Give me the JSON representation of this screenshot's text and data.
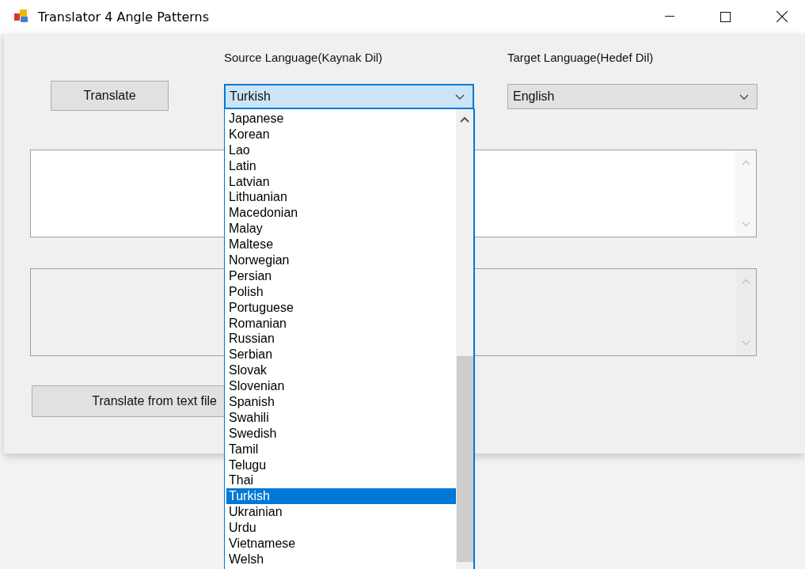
{
  "window": {
    "title": "Translator 4 Angle Patterns"
  },
  "translate_button": "Translate",
  "source": {
    "label": "Source Language(Kaynak Dil)",
    "value": "Turkish",
    "focused": true,
    "expanded": true,
    "options": [
      {
        "label": "Japanese",
        "selected": false
      },
      {
        "label": "Korean",
        "selected": false
      },
      {
        "label": "Lao",
        "selected": false
      },
      {
        "label": "Latin",
        "selected": false
      },
      {
        "label": "Latvian",
        "selected": false
      },
      {
        "label": "Lithuanian",
        "selected": false
      },
      {
        "label": "Macedonian",
        "selected": false
      },
      {
        "label": "Malay",
        "selected": false
      },
      {
        "label": "Maltese",
        "selected": false
      },
      {
        "label": "Norwegian",
        "selected": false
      },
      {
        "label": "Persian",
        "selected": false
      },
      {
        "label": "Polish",
        "selected": false
      },
      {
        "label": "Portuguese",
        "selected": false
      },
      {
        "label": "Romanian",
        "selected": false
      },
      {
        "label": "Russian",
        "selected": false
      },
      {
        "label": "Serbian",
        "selected": false
      },
      {
        "label": "Slovak",
        "selected": false
      },
      {
        "label": "Slovenian",
        "selected": false
      },
      {
        "label": "Spanish",
        "selected": false
      },
      {
        "label": "Swahili",
        "selected": false
      },
      {
        "label": "Swedish",
        "selected": false
      },
      {
        "label": "Tamil",
        "selected": false
      },
      {
        "label": "Telugu",
        "selected": false
      },
      {
        "label": "Thai",
        "selected": false
      },
      {
        "label": "Turkish",
        "selected": true
      },
      {
        "label": "Ukrainian",
        "selected": false
      },
      {
        "label": "Urdu",
        "selected": false
      },
      {
        "label": "Vietnamese",
        "selected": false
      },
      {
        "label": "Welsh",
        "selected": false
      }
    ]
  },
  "target": {
    "label": "Target Language(Hedef Dil)",
    "value": "English",
    "focused": false
  },
  "text_boxes": [
    {
      "read_only": false
    },
    {
      "read_only": true
    }
  ],
  "file_button": "Translate from text file"
}
